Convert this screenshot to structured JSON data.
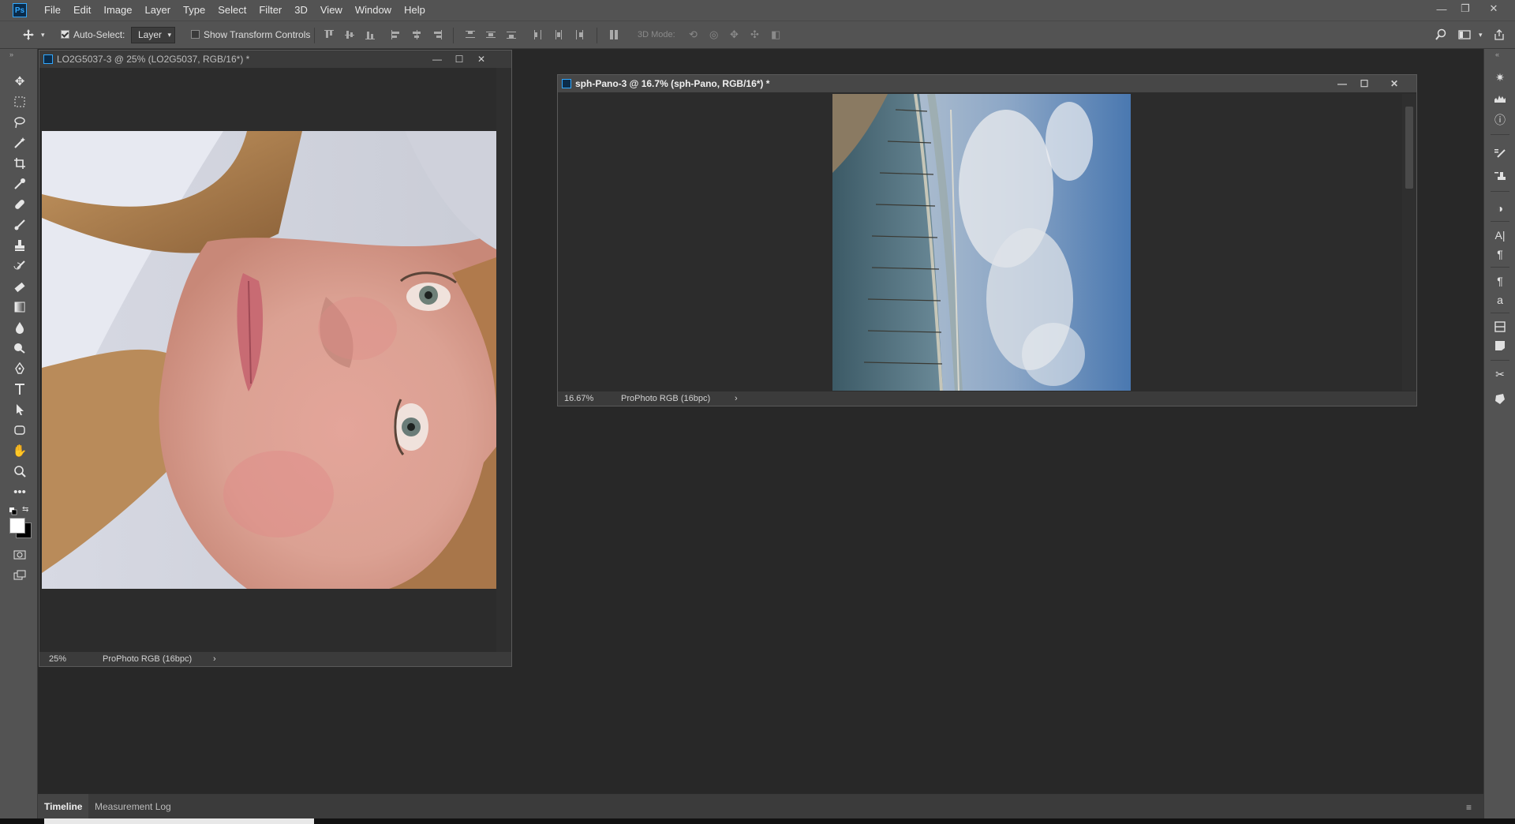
{
  "menubar": {
    "logo": "Ps",
    "items": [
      "File",
      "Edit",
      "Image",
      "Layer",
      "Type",
      "Select",
      "Filter",
      "3D",
      "View",
      "Window",
      "Help"
    ]
  },
  "options": {
    "auto_select_label": "Auto-Select:",
    "auto_select_checked": true,
    "layer_value": "Layer",
    "transform_label": "Show Transform Controls",
    "mode_label": "3D Mode:"
  },
  "doc1": {
    "title": "LO2G5037-3 @ 25% (LO2G5037, RGB/16*) *",
    "zoom": "25%",
    "profile": "ProPhoto RGB (16bpc)",
    "status_arrow": "›"
  },
  "doc2": {
    "title": "sph-Pano-3 @ 16.7% (sph-Pano, RGB/16*) *",
    "zoom": "16.67%",
    "profile": "ProPhoto RGB (16bpc)",
    "status_arrow": "›"
  },
  "bottom": {
    "tabs": [
      "Timeline",
      "Measurement Log"
    ]
  },
  "colors": {
    "chrome": "#535353",
    "canvas": "#282828",
    "accent": "#31a8ff"
  }
}
